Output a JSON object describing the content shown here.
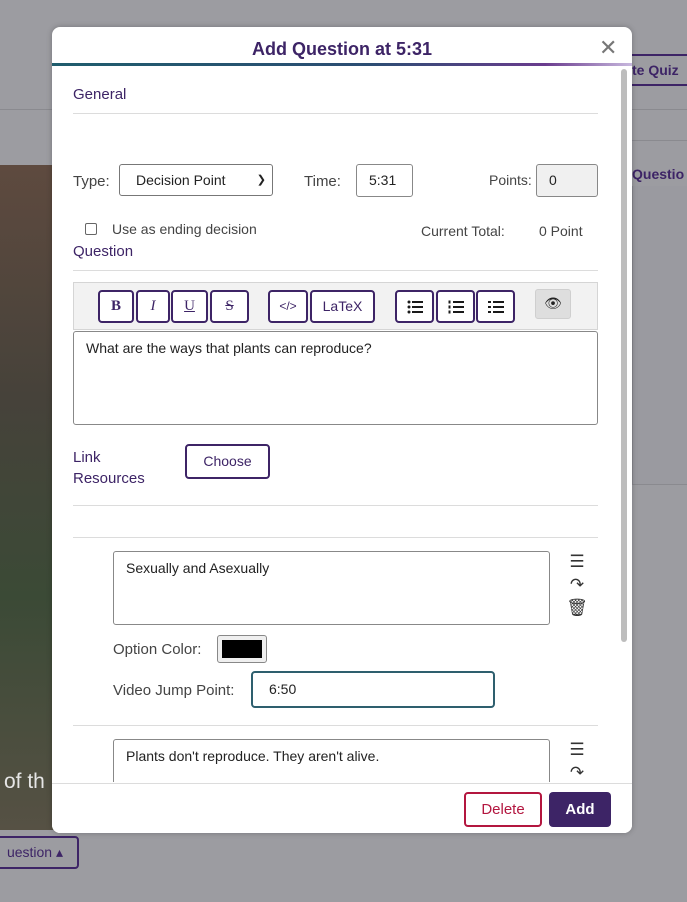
{
  "background": {
    "quiz_button": "te Quiz",
    "question_tab": "Questio",
    "video_caption": "of th",
    "question_button": "uestion ▴"
  },
  "modal": {
    "title": "Add Question at 5:31",
    "close_label": "✕",
    "general": {
      "heading": "General",
      "type_label": "Type:",
      "type_value": "Decision Point",
      "time_label": "Time:",
      "time_value": "5:31",
      "points_label": "Points:",
      "points_value": "0",
      "ending_label": "Use as ending decision",
      "ending_checked": false,
      "total_label": "Current Total:",
      "total_value": "0 Point"
    },
    "question": {
      "heading": "Question",
      "toolbar": {
        "bold": "B",
        "italic": "I",
        "underline": "U",
        "strike": "S",
        "code": "</>",
        "latex": "LaTeX"
      },
      "text": "What are the ways that plants can reproduce?"
    },
    "link_resources": {
      "label_line1": "Link",
      "label_line2": "Resources",
      "choose_label": "Choose"
    },
    "options": [
      {
        "text": "Sexually and Asexually",
        "color_label": "Option Color:",
        "color": "#000000",
        "jump_label": "Video Jump Point:",
        "jump_value": "6:50"
      },
      {
        "text": "Plants don't reproduce. They aren't alive."
      }
    ],
    "footer": {
      "delete_label": "Delete",
      "add_label": "Add"
    }
  },
  "colors": {
    "brand": "#3d2466",
    "danger": "#b3163f",
    "focus": "#2e5f6e"
  }
}
